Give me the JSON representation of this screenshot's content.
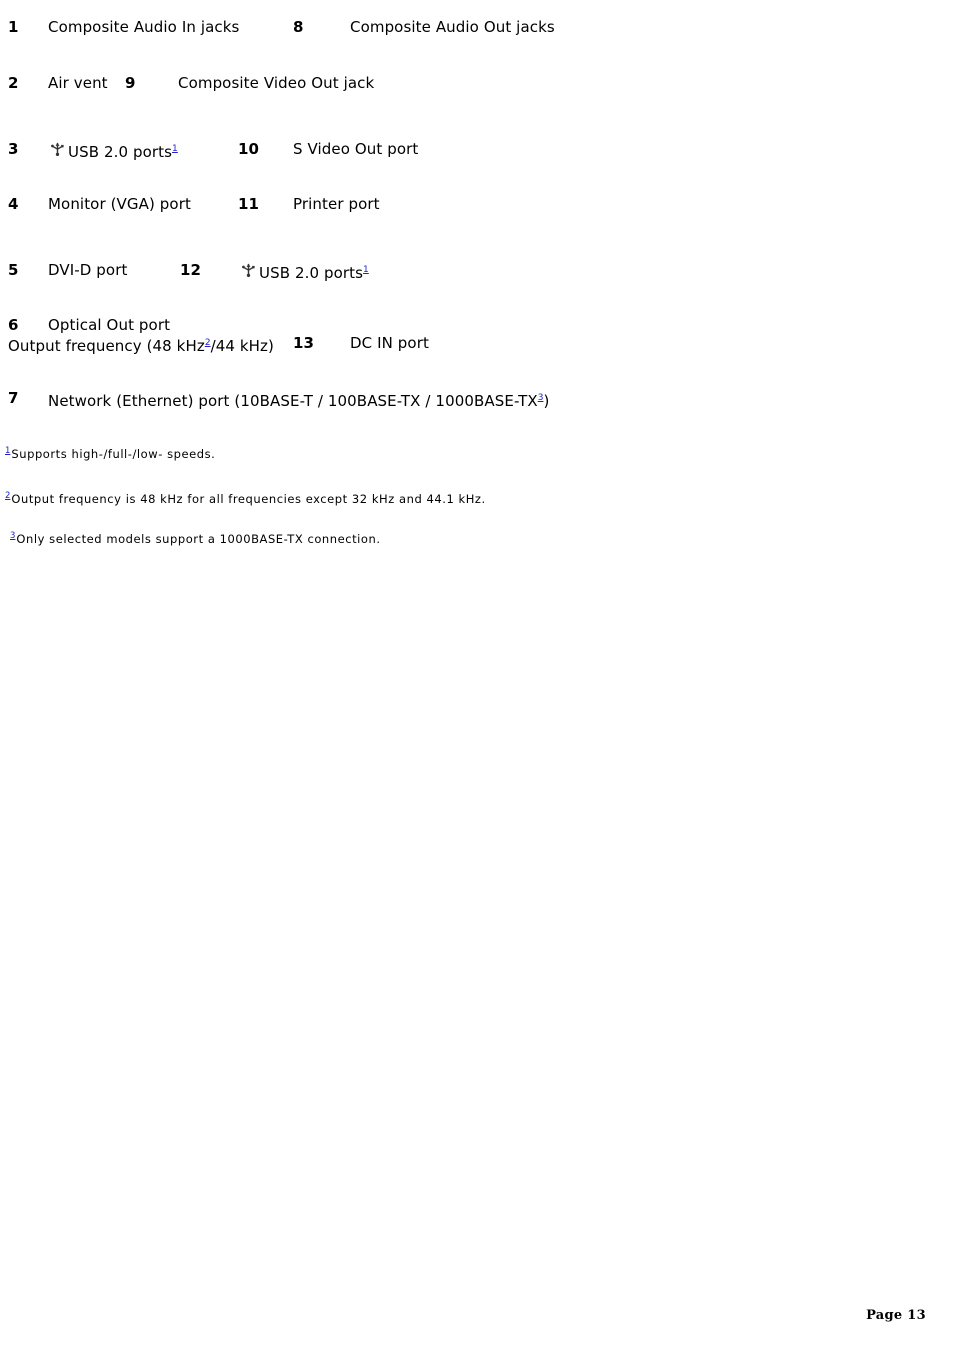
{
  "document": {
    "type": "manual-port-legend",
    "background_color": "#ffffff",
    "text_color": "#000000",
    "link_color": "#2222cc"
  },
  "legend": {
    "items": [
      {
        "number": "1",
        "label": "Composite Audio In jacks"
      },
      {
        "number": "2",
        "label": "Air vent"
      },
      {
        "number": "3",
        "label": "USB 2.0 ports",
        "icon": "usb-icon",
        "footnote": "1"
      },
      {
        "number": "4",
        "label": "Monitor (VGA) port"
      },
      {
        "number": "5",
        "label": "DVI-D port"
      },
      {
        "number": "6",
        "label": "Optical Out port",
        "label_line2": "Output frequency (48 kHz",
        "label_line2_footnote": "2",
        "label_line2_tail": "/44 kHz)"
      },
      {
        "number": "7",
        "label": "Network (Ethernet) port (10BASE-T / 100BASE-TX / 1000BASE-TX",
        "footnote": "3",
        "label_tail": ")"
      },
      {
        "number": "8",
        "label": "Composite Audio Out jacks"
      },
      {
        "number": "9",
        "label": "Composite Video Out jack"
      },
      {
        "number": "10",
        "label": "S Video Out port"
      },
      {
        "number": "11",
        "label": "Printer port"
      },
      {
        "number": "12",
        "label": "USB 2.0 ports",
        "icon": "usb-icon",
        "footnote": "1"
      },
      {
        "number": "13",
        "label": "DC IN port"
      }
    ]
  },
  "footnotes": [
    {
      "mark": "1",
      "text": "Supports high-/full-/low- speeds."
    },
    {
      "mark": "2",
      "text": "Output frequency is 48 kHz for all frequencies except 32 kHz and 44.1 kHz."
    },
    {
      "mark": "3",
      "text": "Only selected models support a 1000BASE-TX connection."
    }
  ],
  "footer": {
    "page_label": "Page 13"
  }
}
